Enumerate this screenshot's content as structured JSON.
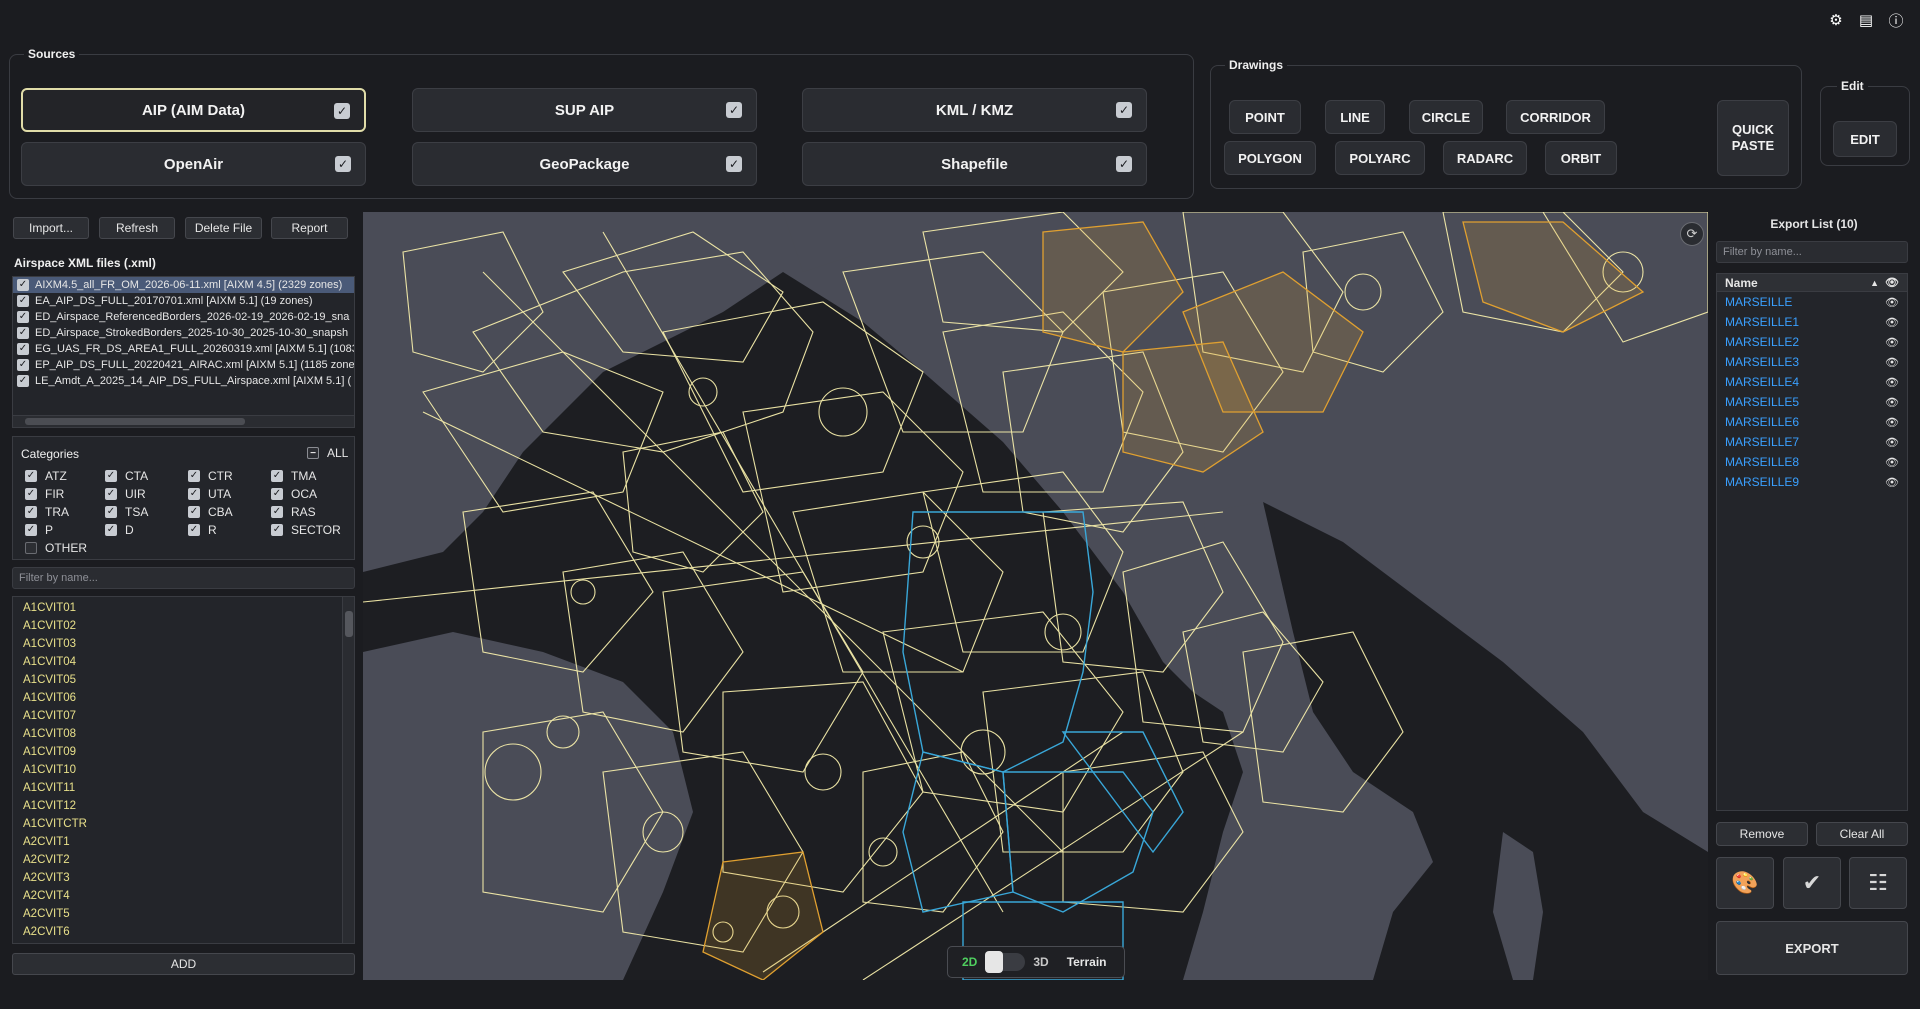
{
  "top_icons": [
    "gear-icon",
    "document-icon",
    "info-icon"
  ],
  "sources": {
    "title": "Sources",
    "buttons": [
      {
        "label": "AIP (AIM Data)",
        "checked": true,
        "active": true
      },
      {
        "label": "SUP AIP",
        "checked": true
      },
      {
        "label": "KML / KMZ",
        "checked": true
      },
      {
        "label": "OpenAir",
        "checked": true
      },
      {
        "label": "GeoPackage",
        "checked": true
      },
      {
        "label": "Shapefile",
        "checked": true
      }
    ]
  },
  "drawings": {
    "title": "Drawings",
    "buttons": [
      "POINT",
      "LINE",
      "CIRCLE",
      "CORRIDOR",
      "POLYGON",
      "POLYARC",
      "RADARC",
      "ORBIT"
    ],
    "quick_paste_line1": "QUICK",
    "quick_paste_line2": "PASTE"
  },
  "edit": {
    "title": "Edit",
    "button": "EDIT"
  },
  "file_actions": [
    "Import...",
    "Refresh",
    "Delete File",
    "Report"
  ],
  "files_label": "Airspace XML files (.xml)",
  "files": [
    "AIXM4.5_all_FR_OM_2026-06-11.xml [AIXM 4.5]  (2329 zones)",
    "EA_AIP_DS_FULL_20170701.xml [AIXM 5.1]  (19 zones)",
    "ED_Airspace_ReferencedBorders_2026-02-19_2026-02-19_sna",
    "ED_Airspace_StrokedBorders_2025-10-30_2025-10-30_snapsh",
    "EG_UAS_FR_DS_AREA1_FULL_20260319.xml [AIXM 5.1]  (1083",
    "EP_AIP_DS_FULL_20220421_AIRAC.xml [AIXM 5.1]  (1185 zone",
    "LE_Amdt_A_2025_14_AIP_DS_FULL_Airspace.xml [AIXM 5.1]  ("
  ],
  "categories": {
    "title": "Categories",
    "all_label": "ALL",
    "items": [
      {
        "label": "ATZ",
        "checked": true
      },
      {
        "label": "CTA",
        "checked": true
      },
      {
        "label": "CTR",
        "checked": true
      },
      {
        "label": "TMA",
        "checked": true
      },
      {
        "label": "FIR",
        "checked": true
      },
      {
        "label": "UIR",
        "checked": true
      },
      {
        "label": "UTA",
        "checked": true
      },
      {
        "label": "OCA",
        "checked": true
      },
      {
        "label": "TRA",
        "checked": true
      },
      {
        "label": "TSA",
        "checked": true
      },
      {
        "label": "CBA",
        "checked": true
      },
      {
        "label": "RAS",
        "checked": true
      },
      {
        "label": "P",
        "checked": true
      },
      {
        "label": "D",
        "checked": true
      },
      {
        "label": "R",
        "checked": true
      },
      {
        "label": "SECTOR",
        "checked": true
      },
      {
        "label": "OTHER",
        "checked": false
      }
    ]
  },
  "zone_filter_placeholder": "Filter by name...",
  "zones": [
    "A1CVIT01",
    "A1CVIT02",
    "A1CVIT03",
    "A1CVIT04",
    "A1CVIT05",
    "A1CVIT06",
    "A1CVIT07",
    "A1CVIT08",
    "A1CVIT09",
    "A1CVIT10",
    "A1CVIT11",
    "A1CVIT12",
    "A1CVITCTR",
    "A2CVIT1",
    "A2CVIT2",
    "A2CVIT3",
    "A2CVIT4",
    "A2CVIT5",
    "A2CVIT6"
  ],
  "add_button": "ADD",
  "map_mode": {
    "label_2d": "2D",
    "label_3d": "3D",
    "terrain": "Terrain",
    "mode": "2D"
  },
  "export": {
    "title": "Export List (10)",
    "filter_placeholder": "Filter by name...",
    "column": "Name",
    "items": [
      "MARSEILLE",
      "MARSEILLE1",
      "MARSEILLE2",
      "MARSEILLE3",
      "MARSEILLE4",
      "MARSEILLE5",
      "MARSEILLE6",
      "MARSEILLE7",
      "MARSEILLE8",
      "MARSEILLE9"
    ],
    "remove": "Remove",
    "clear_all": "Clear All",
    "tools": [
      "palette-icon",
      "verified-badge-icon",
      "sliders-icon"
    ],
    "export_button": "EXPORT"
  },
  "colors": {
    "background": "#1b1c20",
    "map_land": "#4a4c57",
    "map_sea": "#1d1e22",
    "airspace_yellow": "#f4ecaa",
    "airspace_orange": "#e0a030",
    "airspace_blue": "#39a7d8",
    "export_link": "#3aa0ff",
    "zone_text": "#e8e08a"
  }
}
